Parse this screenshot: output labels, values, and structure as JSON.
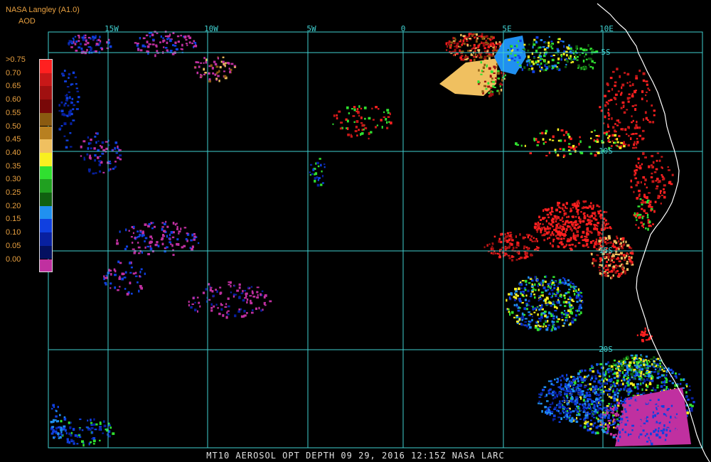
{
  "header": {
    "source": "NASA Langley (A1.0)",
    "product": "AOD"
  },
  "legend": {
    "labels": [
      ">0.75",
      "0.70",
      "0.65",
      "0.60",
      "0.55",
      "0.50",
      "0.45",
      "0.40",
      "0.35",
      "0.30",
      "0.25",
      "0.20",
      "0.15",
      "0.10",
      "0.05",
      "0.00"
    ],
    "colors": [
      "#ff2020",
      "#c81818",
      "#a01010",
      "#780808",
      "#8a5a10",
      "#b88020",
      "#f0c060",
      "#f8f020",
      "#30e030",
      "#20a020",
      "#106010",
      "#2090f0",
      "#1040e0",
      "#0820a0",
      "#041060",
      "#c030a0"
    ]
  },
  "grid": {
    "lon_labels": [
      "15W",
      "10W",
      "5W",
      "0",
      "5E",
      "10E"
    ],
    "lat_labels": [
      "5S",
      "10S",
      "15S",
      "20S"
    ],
    "color": "#40d0d0"
  },
  "footer": "MT10  AEROSOL OPT DEPTH   09 29, 2016 12:15Z   NASA LARC"
}
